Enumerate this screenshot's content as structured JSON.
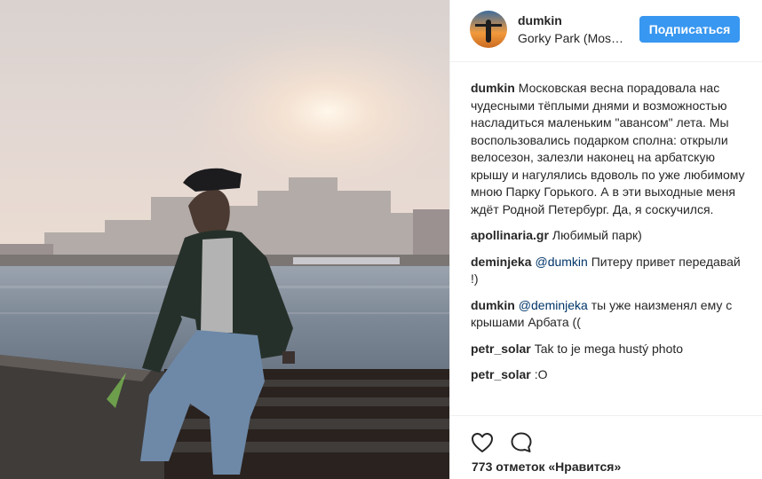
{
  "post": {
    "username": "dumkin",
    "location": "Gorky Park (Mos…",
    "follow_label": "Подписаться",
    "caption": {
      "user": "dumkin",
      "text": "Московская весна порадовала нас чудесными тёплыми днями и возможностью насладиться маленьким \"авансом\" лета. Мы воспользовались подарком сполна: открыли велосезон, залезли наконец на арбатскую крышу и нагулялись вдоволь по уже любимому мною Парку Горького. А в эти выходные меня ждёт Родной Петербург. Да, я соскучился."
    },
    "comments": [
      {
        "user": "apollinaria.gr",
        "mention": "",
        "text": "Любимый парк)"
      },
      {
        "user": "deminjeka",
        "mention": "@dumkin",
        "text": " Питеру привет передавай !)"
      },
      {
        "user": "dumkin",
        "mention": "@deminjeka",
        "text": " ты уже наизменял ему с крышами Арбата (("
      },
      {
        "user": "petr_solar",
        "mention": "",
        "text": "Tak to je mega hustý photo"
      },
      {
        "user": "petr_solar",
        "mention": "",
        "text": ":O"
      }
    ],
    "likes_text": "773 отметок «Нравится»"
  },
  "icons": {
    "like": "heart-icon",
    "comment": "speech-bubble-icon"
  },
  "colors": {
    "follow_button": "#3897f0",
    "mention": "#003569",
    "text": "#262626"
  }
}
